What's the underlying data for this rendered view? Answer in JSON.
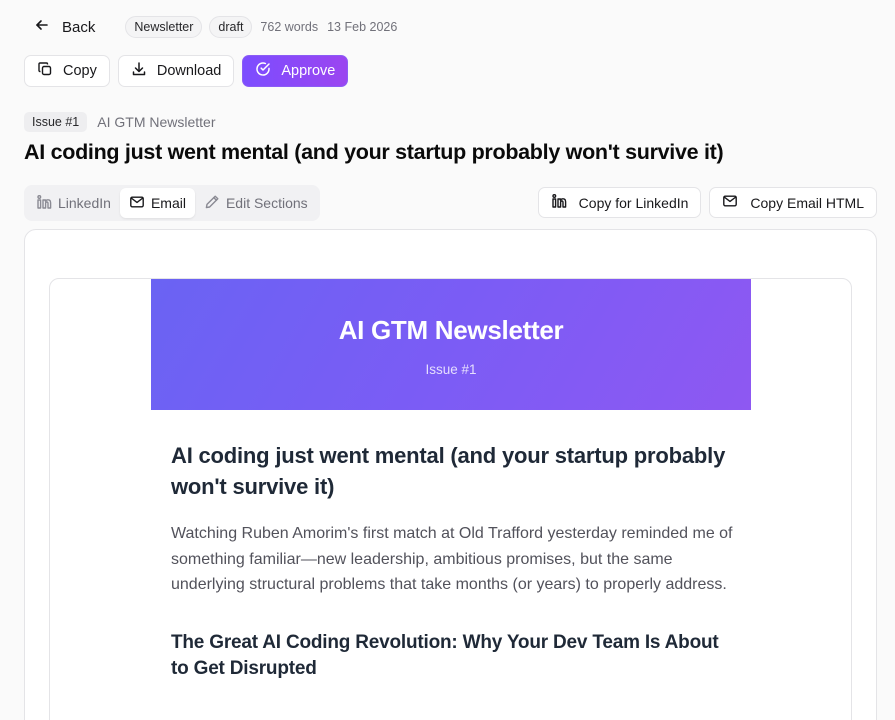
{
  "topbar": {
    "back_label": "Back",
    "type_badge": "Newsletter",
    "status_badge": "draft",
    "word_count": "762 words",
    "date": "13 Feb 2026"
  },
  "actions": {
    "copy_label": "Copy",
    "download_label": "Download",
    "approve_label": "Approve"
  },
  "issue": {
    "badge": "Issue #1",
    "newsletter_name": "AI GTM Newsletter"
  },
  "page_title": "AI coding just went mental (and your startup probably won't survive it)",
  "tabs": [
    {
      "label": "LinkedIn",
      "icon": "linkedin-icon",
      "active": false
    },
    {
      "label": "Email",
      "icon": "mail-icon",
      "active": true
    },
    {
      "label": "Edit Sections",
      "icon": "pencil-icon",
      "active": false
    }
  ],
  "export": {
    "copy_linkedin_label": "Copy for LinkedIn",
    "copy_email_html_label": "Copy Email HTML"
  },
  "email": {
    "header_title": "AI GTM Newsletter",
    "header_issue": "Issue #1",
    "headline": "AI coding just went mental (and your startup probably won't survive it)",
    "intro": "Watching Ruben Amorim's first match at Old Trafford yesterday reminded me of something familiar—new leadership, ambitious promises, but the same underlying structural problems that take months (or years) to properly address.",
    "section_heading": "The Great AI Coding Revolution: Why Your Dev Team Is About to Get Disrupted"
  },
  "colors": {
    "accent": "#8b5cf6",
    "accent_gradient_start": "#7c4dff",
    "header_gradient_start": "#6a63f3",
    "header_gradient_end": "#8e58f2"
  }
}
